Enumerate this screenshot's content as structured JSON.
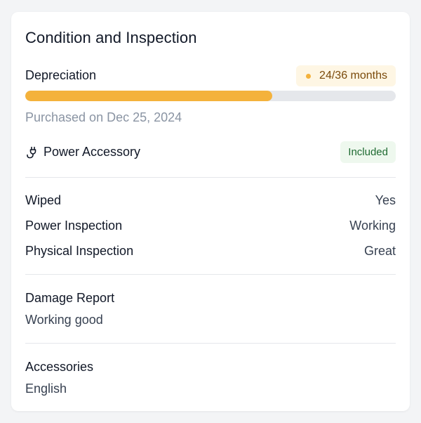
{
  "card": {
    "title": "Condition and Inspection"
  },
  "depreciation": {
    "label": "Depreciation",
    "badge_text": "24/36 months",
    "progress_fraction": 0.6667,
    "purchased_text": "Purchased on Dec 25, 2024"
  },
  "power_accessory": {
    "label": "Power Accessory",
    "icon": "plug-icon",
    "status": "Included"
  },
  "inspection": [
    {
      "key": "Wiped",
      "value": "Yes"
    },
    {
      "key": "Power Inspection",
      "value": "Working"
    },
    {
      "key": "Physical Inspection",
      "value": "Great"
    }
  ],
  "damage_report": {
    "heading": "Damage Report",
    "value": "Working good"
  },
  "accessories": {
    "heading": "Accessories",
    "value": "English"
  },
  "colors": {
    "accent": "#f4b23c",
    "badge_bg": "#fef6e4",
    "success_bg": "#eef8ee",
    "success_text": "#1f6b32"
  }
}
